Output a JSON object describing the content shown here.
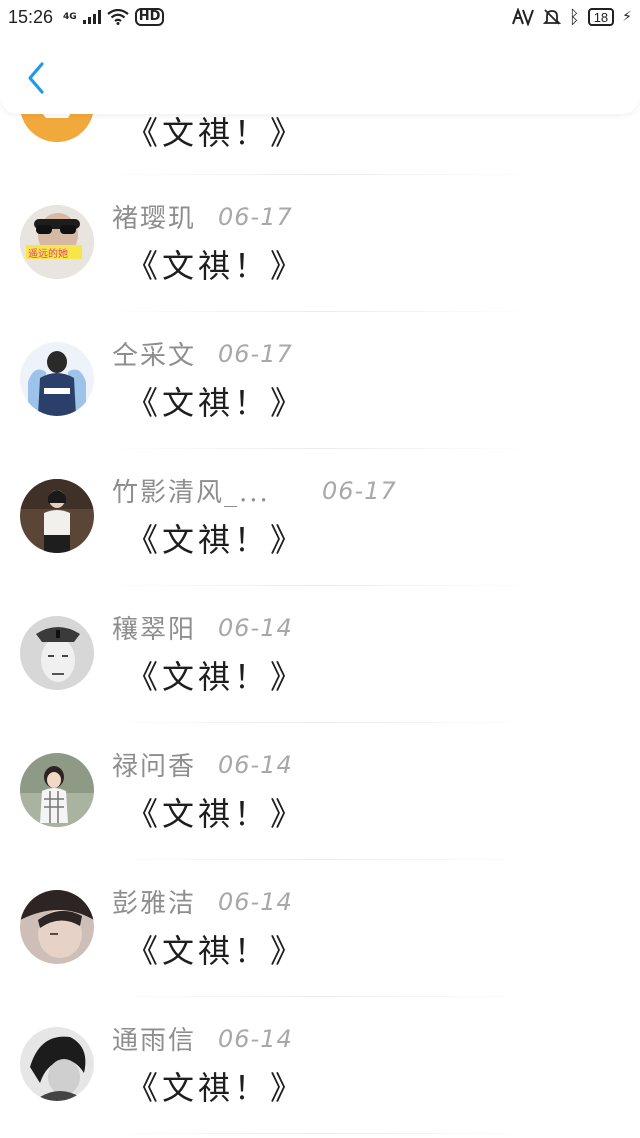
{
  "status_bar": {
    "time": "15:26",
    "network": "4G",
    "hd": "HD",
    "battery": "18"
  },
  "header": {
    "back_icon": "chevron-left-icon",
    "accent": "#1e9be8"
  },
  "messages": [
    {
      "name": "",
      "date": "",
      "text": "《文祺！》"
    },
    {
      "name": "褚璎玑",
      "date": "06-17",
      "text": "《文祺！》"
    },
    {
      "name": "仝采文",
      "date": "06-17",
      "text": "《文祺！》"
    },
    {
      "name": "竹影清风_...",
      "date": "06-17",
      "text": "《文祺！》"
    },
    {
      "name": "穰翠阳",
      "date": "06-14",
      "text": "《文祺！》"
    },
    {
      "name": "禄问香",
      "date": "06-14",
      "text": "《文祺！》"
    },
    {
      "name": "彭雅洁",
      "date": "06-14",
      "text": "《文祺！》"
    },
    {
      "name": "通雨信",
      "date": "06-14",
      "text": "《文祺！》"
    }
  ],
  "avatar_badge": "遥远的她"
}
